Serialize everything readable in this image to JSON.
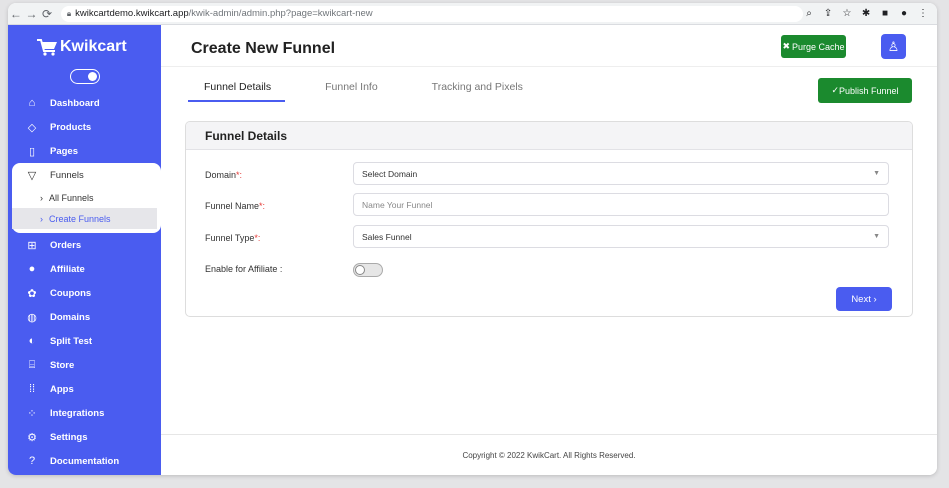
{
  "browser": {
    "url_host": "kwikcartdemo.kwikcart.app",
    "url_path": "/kwik-admin/admin.php?page=kwikcart-new"
  },
  "sidebar": {
    "brand": "Kwikcart",
    "items": [
      {
        "label": "Dashboard",
        "icon": "home-icon"
      },
      {
        "label": "Products",
        "icon": "tag-icon"
      },
      {
        "label": "Pages",
        "icon": "page-icon"
      },
      {
        "label": "Funnels",
        "icon": "funnel-icon"
      },
      {
        "label": "Orders",
        "icon": "orders-icon"
      },
      {
        "label": "Affiliate",
        "icon": "affiliate-icon"
      },
      {
        "label": "Coupons",
        "icon": "coupon-icon"
      },
      {
        "label": "Domains",
        "icon": "globe-icon"
      },
      {
        "label": "Split Test",
        "icon": "split-icon"
      },
      {
        "label": "Store",
        "icon": "store-icon"
      },
      {
        "label": "Apps",
        "icon": "grid-icon"
      },
      {
        "label": "Integrations",
        "icon": "integrations-icon"
      },
      {
        "label": "Settings",
        "icon": "gear-icon"
      },
      {
        "label": "Documentation",
        "icon": "question-icon"
      }
    ],
    "funnel_sub": [
      {
        "label": "All Funnels"
      },
      {
        "label": "Create Funnels"
      }
    ]
  },
  "header": {
    "title": "Create New Funnel",
    "purge_label": "Purge Cache"
  },
  "tabs": [
    {
      "label": "Funnel Details"
    },
    {
      "label": "Funnel Info"
    },
    {
      "label": "Tracking and Pixels"
    }
  ],
  "publish_label": "Publish Funnel",
  "card": {
    "title": "Funnel Details",
    "domain_label": "Domain",
    "domain_value": "Select Domain",
    "name_label": "Funnel Name",
    "name_placeholder": "Name Your Funnel",
    "type_label": "Funnel Type",
    "type_value": "Sales Funnel",
    "affiliate_label": "Enable for Affiliate :",
    "required_mark": "*:",
    "next_label": "Next"
  },
  "footer": "Copyright © 2022 KwikCart. All Rights Reserved.",
  "colors": {
    "accent": "#4a5cf0",
    "success": "#1b8a2e",
    "required": "#e53935"
  }
}
